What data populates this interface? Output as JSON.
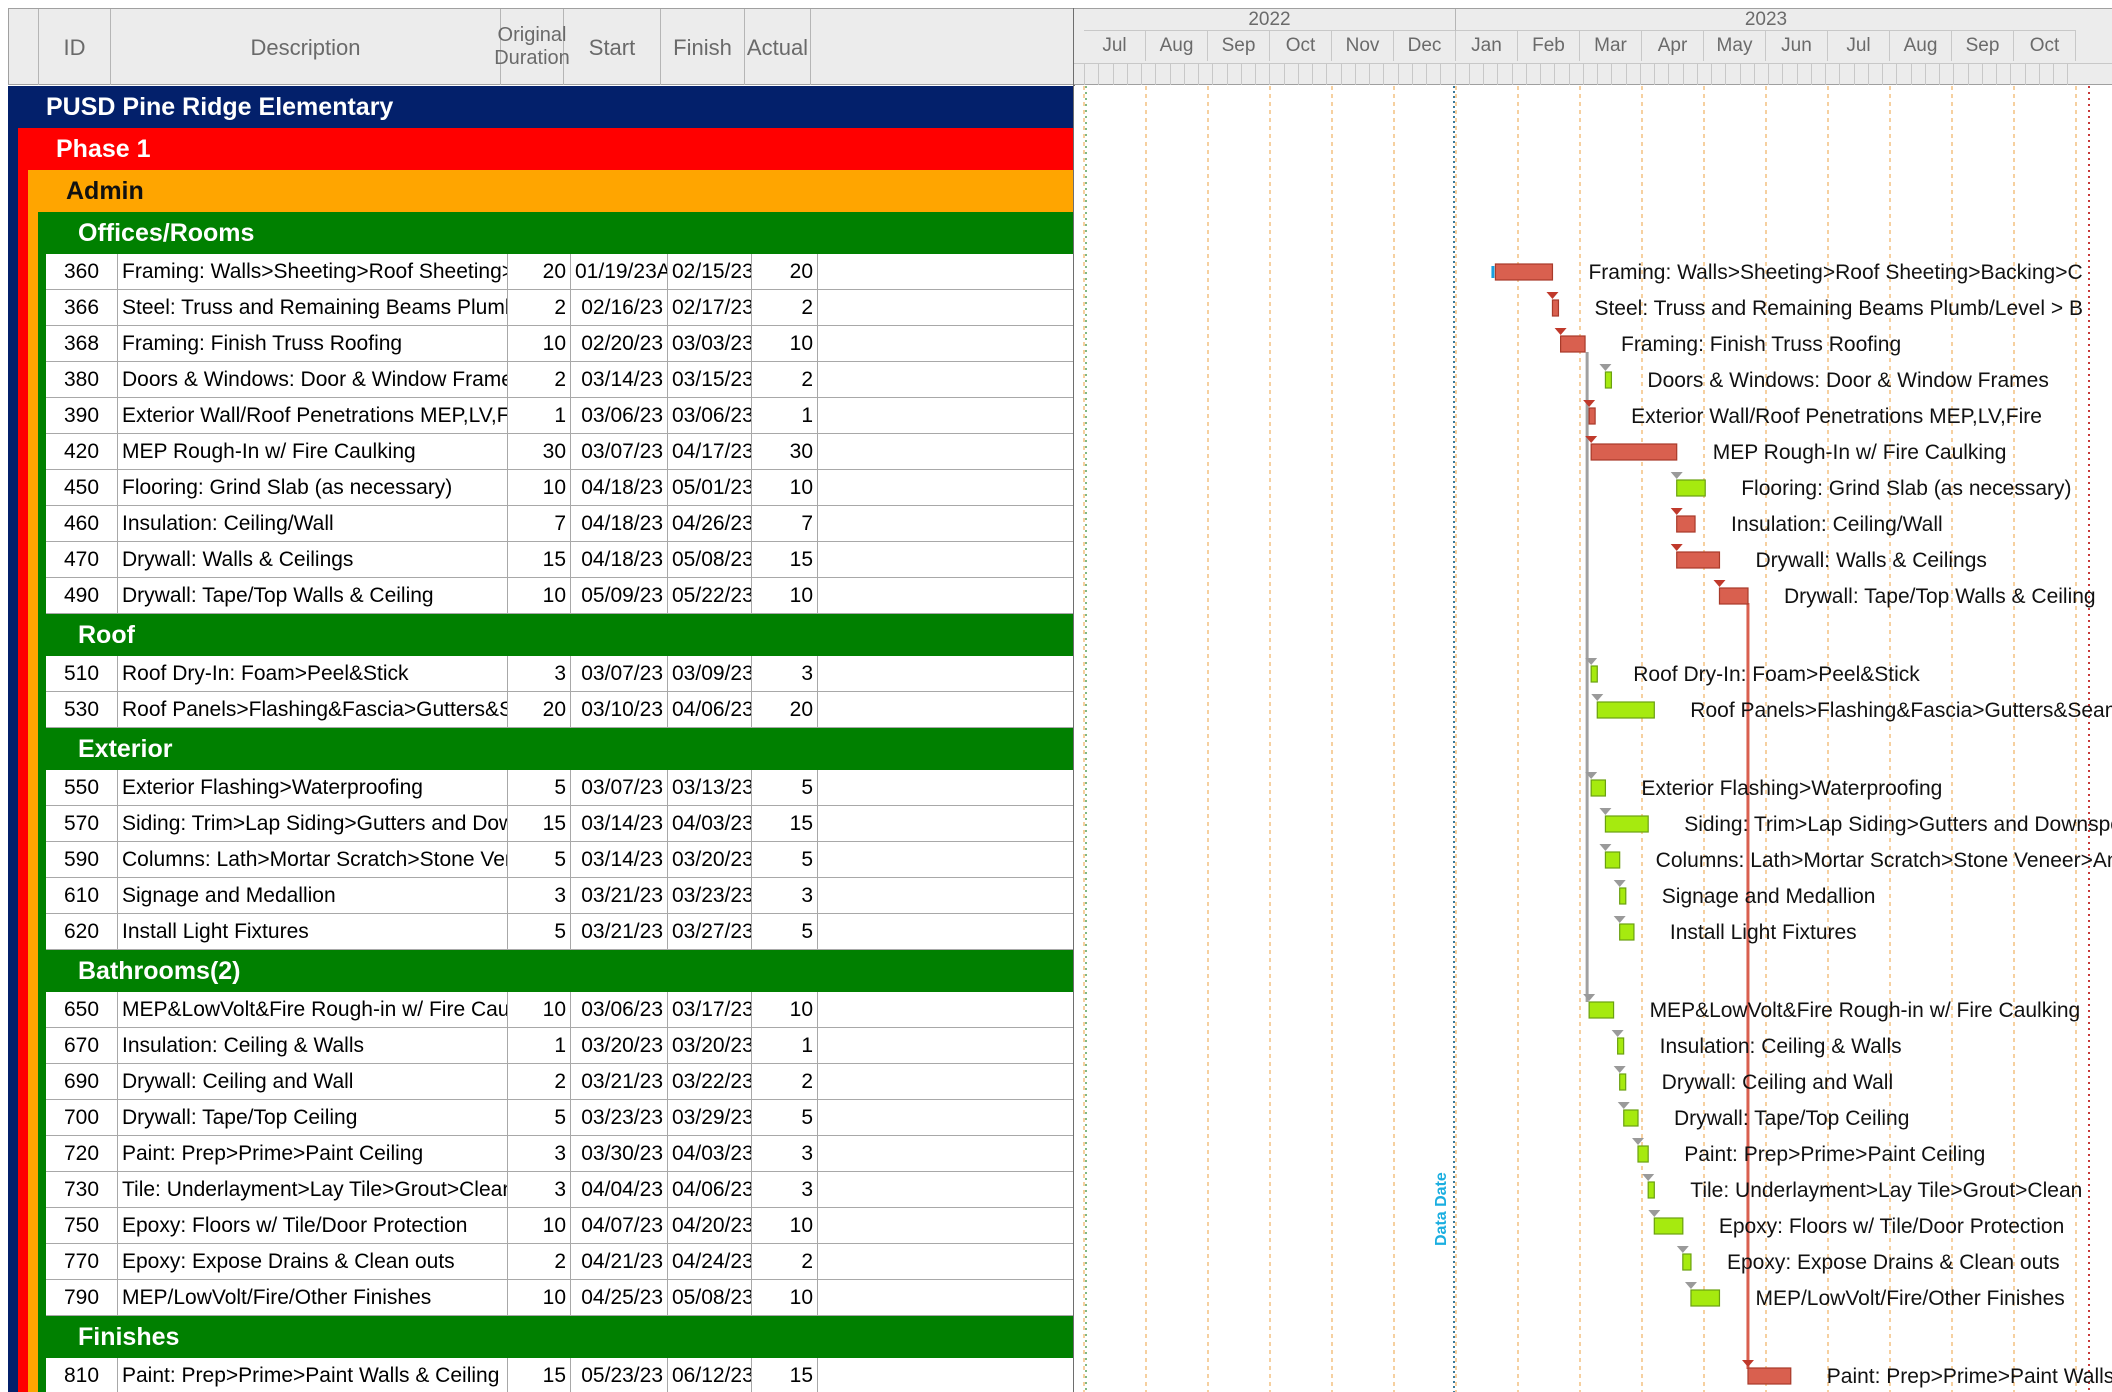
{
  "columns": {
    "id": "ID",
    "description": "Description",
    "original_duration": "Original\nDuration",
    "start": "Start",
    "finish": "Finish",
    "actual": "Actual"
  },
  "timeline": {
    "years": [
      "2022",
      "2023"
    ],
    "months": [
      "Jul",
      "Aug",
      "Sep",
      "Oct",
      "Nov",
      "Dec",
      "Jan",
      "Feb",
      "Mar",
      "Apr",
      "May",
      "Jun",
      "Jul",
      "Aug",
      "Sep",
      "Oct"
    ],
    "data_date_label": "Data Date"
  },
  "colors": {
    "project_band": "#03206b",
    "phase_band": "#ff0000",
    "area_band": "#ffa500",
    "subgroup_band": "#008000",
    "critical_bar": "#d9604f",
    "noncritical_bar": "#a6ea0f",
    "data_date_line": "#1aaee0",
    "month_grid": "#f0b060"
  },
  "bands": {
    "project": "PUSD Pine Ridge Elementary",
    "phase": "Phase 1",
    "area": "Admin"
  },
  "sections": [
    {
      "name": "Offices/Rooms",
      "tasks": [
        {
          "id": "360",
          "desc": "Framing: Walls>Sheeting>Roof Sheeting>Backing>C",
          "dur": "20",
          "start": "01/19/23A",
          "finish": "02/15/23",
          "actual": "20",
          "critical": true
        },
        {
          "id": "366",
          "desc": "Steel: Truss and Remaining Beams Plumb/Level > B",
          "dur": "2",
          "start": "02/16/23",
          "finish": "02/17/23",
          "actual": "2",
          "critical": true
        },
        {
          "id": "368",
          "desc": "Framing: Finish Truss Roofing",
          "dur": "10",
          "start": "02/20/23",
          "finish": "03/03/23",
          "actual": "10",
          "critical": true
        },
        {
          "id": "380",
          "desc": "Doors & Windows: Door & Window Frames",
          "dur": "2",
          "start": "03/14/23",
          "finish": "03/15/23",
          "actual": "2",
          "critical": false
        },
        {
          "id": "390",
          "desc": "Exterior Wall/Roof Penetrations MEP,LV,Fire",
          "dur": "1",
          "start": "03/06/23",
          "finish": "03/06/23",
          "actual": "1",
          "critical": true
        },
        {
          "id": "420",
          "desc": "MEP Rough-In w/ Fire Caulking",
          "dur": "30",
          "start": "03/07/23",
          "finish": "04/17/23",
          "actual": "30",
          "critical": true
        },
        {
          "id": "450",
          "desc": "Flooring: Grind Slab (as necessary)",
          "dur": "10",
          "start": "04/18/23",
          "finish": "05/01/23",
          "actual": "10",
          "critical": false
        },
        {
          "id": "460",
          "desc": "Insulation: Ceiling/Wall",
          "dur": "7",
          "start": "04/18/23",
          "finish": "04/26/23",
          "actual": "7",
          "critical": true
        },
        {
          "id": "470",
          "desc": "Drywall: Walls & Ceilings",
          "dur": "15",
          "start": "04/18/23",
          "finish": "05/08/23",
          "actual": "15",
          "critical": true
        },
        {
          "id": "490",
          "desc": "Drywall: Tape/Top Walls & Ceiling",
          "dur": "10",
          "start": "05/09/23",
          "finish": "05/22/23",
          "actual": "10",
          "critical": true
        }
      ]
    },
    {
      "name": "Roof",
      "tasks": [
        {
          "id": "510",
          "desc": "Roof Dry-In: Foam>Peel&Stick",
          "dur": "3",
          "start": "03/07/23",
          "finish": "03/09/23",
          "actual": "3",
          "critical": false
        },
        {
          "id": "530",
          "desc": "Roof Panels>Flashing&Fascia>Gutters&Seams",
          "dur": "20",
          "start": "03/10/23",
          "finish": "04/06/23",
          "actual": "20",
          "critical": false
        }
      ]
    },
    {
      "name": "Exterior",
      "tasks": [
        {
          "id": "550",
          "desc": "Exterior Flashing>Waterproofing",
          "dur": "5",
          "start": "03/07/23",
          "finish": "03/13/23",
          "actual": "5",
          "critical": false
        },
        {
          "id": "570",
          "desc": "Siding: Trim>Lap Siding>Gutters and Downspouts",
          "dur": "15",
          "start": "03/14/23",
          "finish": "04/03/23",
          "actual": "15",
          "critical": false
        },
        {
          "id": "590",
          "desc": "Columns: Lath>Mortar Scratch>Stone Veneer>Anti-C",
          "dur": "5",
          "start": "03/14/23",
          "finish": "03/20/23",
          "actual": "5",
          "critical": false
        },
        {
          "id": "610",
          "desc": "Signage and Medallion",
          "dur": "3",
          "start": "03/21/23",
          "finish": "03/23/23",
          "actual": "3",
          "critical": false
        },
        {
          "id": "620",
          "desc": "Install Light Fixtures",
          "dur": "5",
          "start": "03/21/23",
          "finish": "03/27/23",
          "actual": "5",
          "critical": false
        }
      ]
    },
    {
      "name": "Bathrooms(2)",
      "tasks": [
        {
          "id": "650",
          "desc": "MEP&LowVolt&Fire Rough-in w/ Fire Caulking",
          "dur": "10",
          "start": "03/06/23",
          "finish": "03/17/23",
          "actual": "10",
          "critical": false
        },
        {
          "id": "670",
          "desc": "Insulation: Ceiling & Walls",
          "dur": "1",
          "start": "03/20/23",
          "finish": "03/20/23",
          "actual": "1",
          "critical": false
        },
        {
          "id": "690",
          "desc": "Drywall: Ceiling and Wall",
          "dur": "2",
          "start": "03/21/23",
          "finish": "03/22/23",
          "actual": "2",
          "critical": false
        },
        {
          "id": "700",
          "desc": "Drywall: Tape/Top Ceiling",
          "dur": "5",
          "start": "03/23/23",
          "finish": "03/29/23",
          "actual": "5",
          "critical": false
        },
        {
          "id": "720",
          "desc": "Paint: Prep>Prime>Paint Ceiling",
          "dur": "3",
          "start": "03/30/23",
          "finish": "04/03/23",
          "actual": "3",
          "critical": false
        },
        {
          "id": "730",
          "desc": "Tile: Underlayment>Lay Tile>Grout>Clean",
          "dur": "3",
          "start": "04/04/23",
          "finish": "04/06/23",
          "actual": "3",
          "critical": false
        },
        {
          "id": "750",
          "desc": "Epoxy: Floors w/ Tile/Door Protection",
          "dur": "10",
          "start": "04/07/23",
          "finish": "04/20/23",
          "actual": "10",
          "critical": false
        },
        {
          "id": "770",
          "desc": "Epoxy: Expose Drains & Clean outs",
          "dur": "2",
          "start": "04/21/23",
          "finish": "04/24/23",
          "actual": "2",
          "critical": false
        },
        {
          "id": "790",
          "desc": "MEP/LowVolt/Fire/Other Finishes",
          "dur": "10",
          "start": "04/25/23",
          "finish": "05/08/23",
          "actual": "10",
          "critical": false
        }
      ]
    },
    {
      "name": "Finishes",
      "tasks": [
        {
          "id": "810",
          "desc": "Paint: Prep>Prime>Paint Walls & Ceiling",
          "dur": "15",
          "start": "05/23/23",
          "finish": "06/12/23",
          "actual": "15",
          "critical": true
        }
      ]
    }
  ]
}
